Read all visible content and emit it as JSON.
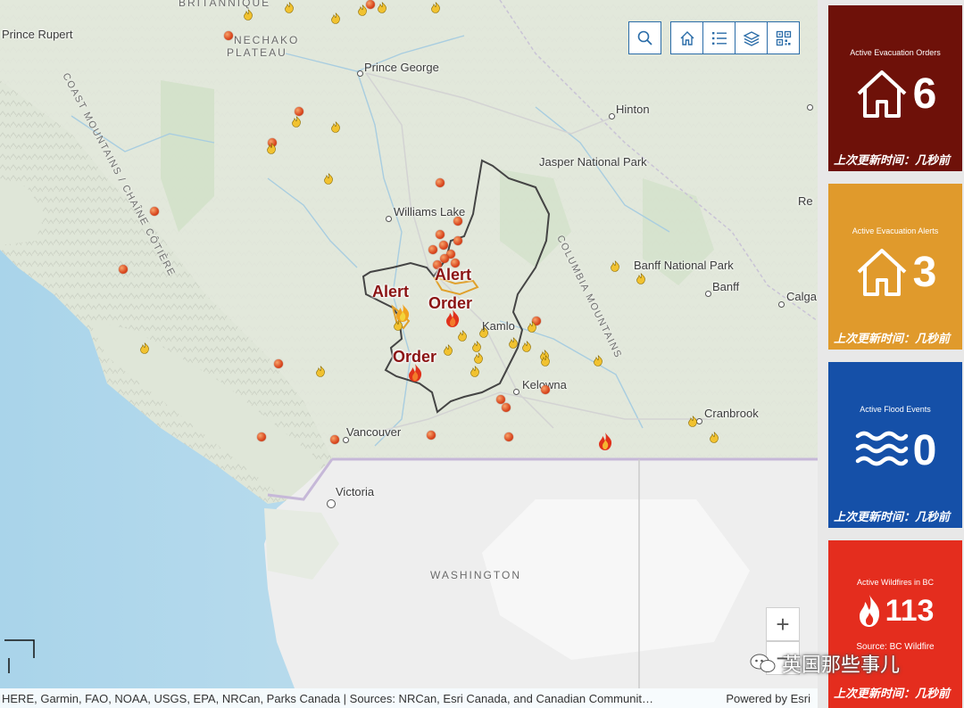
{
  "map": {
    "places": {
      "prince_rupert": "Prince Rupert",
      "prince_george": "Prince George",
      "hinton": "Hinton",
      "jasper": "Jasper National Park",
      "williams_lake": "Williams Lake",
      "banff_np": "Banff National Park",
      "banff": "Banff",
      "calgary": "Calga",
      "red_deer": "Re",
      "kamloops": "Kamlo",
      "kelowna": "Kelowna",
      "cranbrook": "Cranbrook",
      "vancouver": "Vancouver",
      "victoria": "Victoria",
      "washington": "WASHINGTON"
    },
    "regions": {
      "nechako_1": "NECHAKO",
      "nechako_2": "PLATEAU",
      "britannique": "BRITANNIQUE",
      "coast_mountains": "COAST MOUNTAINS / CHAÎNE CÔTIÈRE",
      "columbia_mountains": "COLUMBIA MOUNTAINS"
    },
    "evac_labels": {
      "alert_1": "Alert",
      "alert_2": "Alert",
      "order_1": "Order",
      "order_2": "Order"
    },
    "toolbar": {
      "search_icon": "search-icon",
      "home_icon": "home-icon",
      "legend_icon": "list-icon",
      "layers_icon": "layers-icon",
      "qr_icon": "qr-code-icon"
    },
    "zoom": {
      "in_label": "+"
    },
    "attribution": {
      "sources": "HERE, Garmin, FAO, NOAA, USGS, EPA, NRCan, Parks Canada | Sources: NRCan, Esri Canada, and Canadian Communit…",
      "powered_by": "Powered by Esri"
    }
  },
  "sidebar": {
    "cards": [
      {
        "title": "Active Evacuation Orders",
        "value": "6",
        "icon": "house-icon",
        "color": "#6e1109",
        "footer": "上次更新时间：几秒前"
      },
      {
        "title": "Active Evacuation Alerts",
        "value": "3",
        "icon": "house-icon",
        "color": "#e09a2c",
        "footer": "上次更新时间：几秒前"
      },
      {
        "title": "Active Flood Events",
        "value": "0",
        "icon": "waves-icon",
        "color": "#1550a8",
        "footer": "上次更新时间：几秒前"
      },
      {
        "title": "Active Wildfires in BC",
        "value": "113",
        "icon": "flame-icon",
        "color": "#e42d1e",
        "source": "Source: BC Wildfire",
        "footer": "上次更新时间：几秒前"
      }
    ]
  },
  "watermark": {
    "text": "英国那些事儿"
  }
}
